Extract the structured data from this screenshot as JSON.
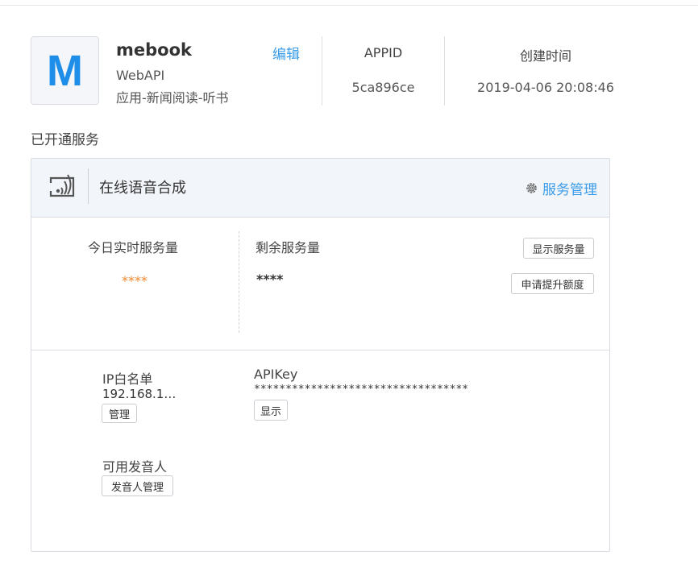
{
  "app": {
    "avatar_letter": "M",
    "name": "mebook",
    "type": "WebAPI",
    "category": "应用-新闻阅读-听书",
    "edit_label": "编辑",
    "appid_label": "APPID",
    "appid_value": "5ca896ce",
    "created_label": "创建时间",
    "created_value": "2019-04-06 20:08:46"
  },
  "section_title": "已开通服务",
  "service": {
    "icon": "voice-broadcast-icon",
    "name": "在线语音合成",
    "manage_icon": "gear-icon",
    "manage_label": "服务管理",
    "today_label": "今日实时服务量",
    "today_value": "****",
    "remaining_label": "剩余服务量",
    "remaining_value": "****",
    "show_usage_button": "显示服务量",
    "request_quota_button": "申请提升额度",
    "ip_whitelist_label": "IP白名单",
    "ip_whitelist_value": "192.168.1…",
    "manage_button": "管理",
    "apikey_label": "APIKey",
    "apikey_mask": "**********************************",
    "show_button": "显示",
    "voices_label": "可用发音人",
    "voices_button": "发音人管理"
  },
  "colors": {
    "accent": "#3a9be8",
    "avatar_letter": "#1f8ee8",
    "highlight_value": "#f0882f",
    "card_header_bg": "#f2f5f9"
  }
}
